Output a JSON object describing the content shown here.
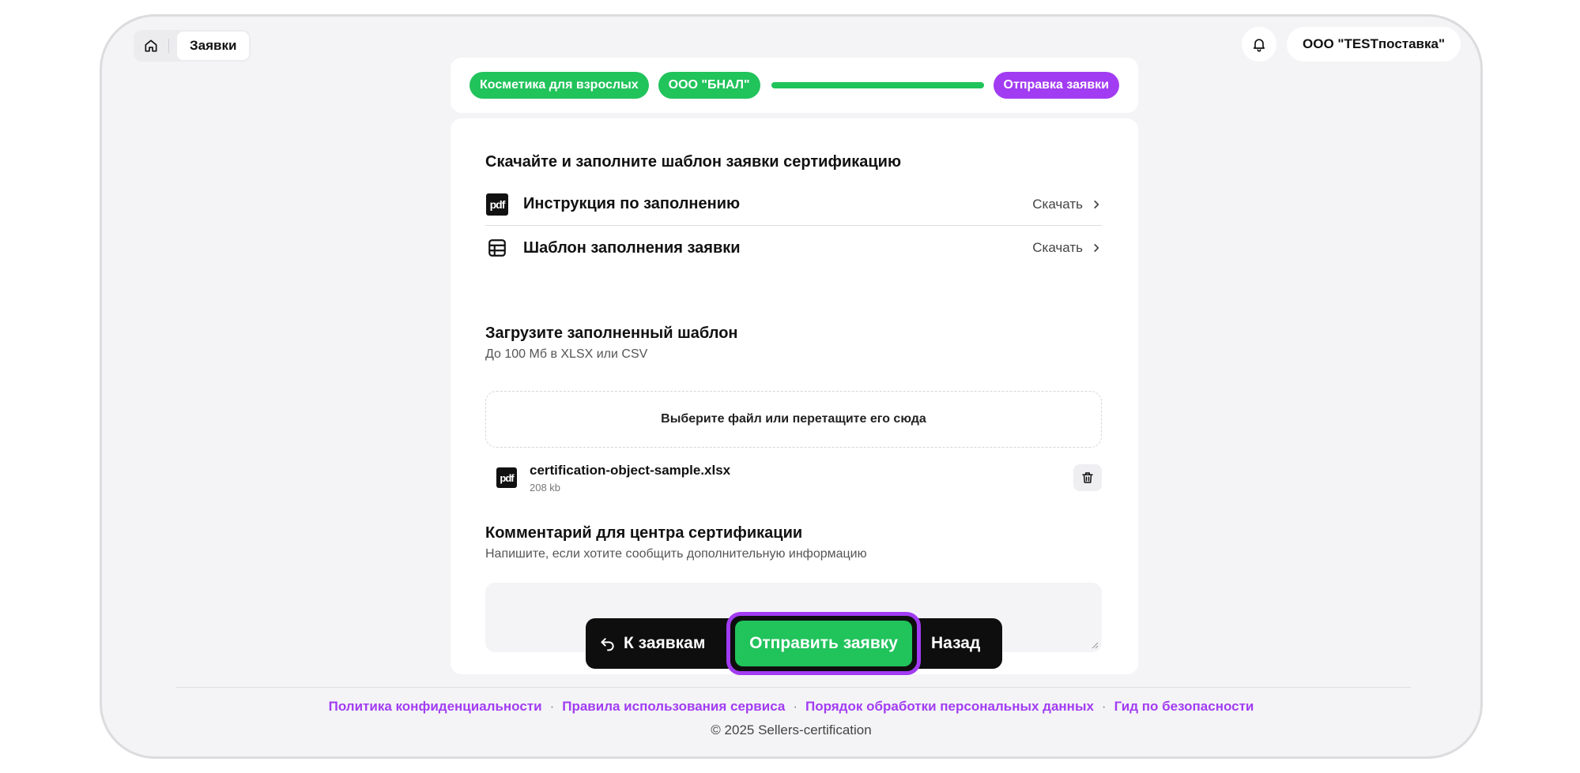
{
  "header": {
    "breadcrumb_page": "Заявки",
    "organization": "ООО \"TESTпоставка\""
  },
  "stepper": {
    "steps": [
      "Косметика для взрослых",
      "ООО \"БНАЛ\"",
      "Отправка заявки"
    ],
    "progress_percent": 100
  },
  "download_section": {
    "title": "Скачайте и заполните шаблон заявки сертификацию",
    "items": [
      {
        "icon": "pdf-icon",
        "label": "Инструкция по заполнению",
        "action": "Скачать"
      },
      {
        "icon": "table-icon",
        "label": "Шаблон заполнения заявки",
        "action": "Скачать"
      }
    ]
  },
  "upload_section": {
    "title": "Загрузите заполненный шаблон",
    "subtitle": "До 100 Мб в XLSX или CSV",
    "dropzone_text": "Выберите файл или перетащите его сюда",
    "file": {
      "name": "certification-object-sample.xlsx",
      "size": "208 kb"
    }
  },
  "comment_section": {
    "title": "Комментарий для центра сертификации",
    "subtitle": "Напишите, если хотите сообщить дополнительную информацию",
    "value": ""
  },
  "actions": {
    "back_to_list": "К заявкам",
    "submit": "Отправить заявку",
    "previous": "Назад"
  },
  "footer": {
    "links": [
      "Политика конфиденциальности",
      "Правила использования сервиса",
      "Порядок обработки персональных данных",
      "Гид по безопасности"
    ],
    "copyright": "© 2025 Sellers-certification"
  },
  "colors": {
    "green": "#21c35b",
    "purple": "#a23cf2",
    "dark": "#0e0e0e"
  }
}
